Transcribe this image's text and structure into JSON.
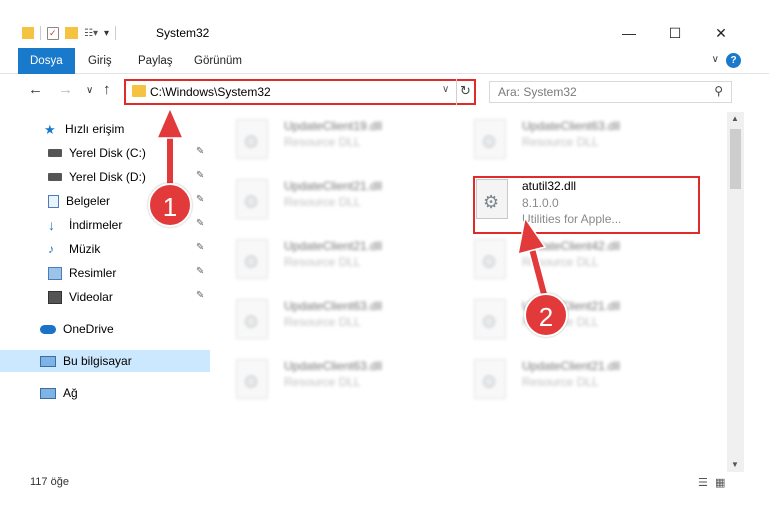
{
  "window": {
    "title": "System32",
    "min_glyph": "—",
    "max_glyph": "☐",
    "close_glyph": "✕"
  },
  "ribbon": {
    "tabs": [
      "Dosya",
      "Giriş",
      "Paylaş",
      "Görünüm"
    ],
    "active_tab": "Dosya",
    "help_glyph": "?",
    "collapse_glyph": "∨"
  },
  "navigation": {
    "back_glyph": "←",
    "forward_glyph": "→",
    "recent_glyph": "∨",
    "up_glyph": "↑",
    "address_path": "C:\\Windows\\System32",
    "address_dropdown_glyph": "∨",
    "refresh_glyph": "↻",
    "search_placeholder": "Ara: System32",
    "search_icon_glyph": "⚲"
  },
  "sidebar": {
    "items": [
      {
        "label": "Hızlı erişim",
        "icon": "star-icon",
        "pinned": false,
        "selected": false
      },
      {
        "label": "Yerel Disk (C:)",
        "icon": "drive-icon",
        "pinned": true,
        "selected": false
      },
      {
        "label": "Yerel Disk (D:)",
        "icon": "drive-icon",
        "pinned": true,
        "selected": false
      },
      {
        "label": "Belgeler",
        "icon": "documents-icon",
        "pinned": true,
        "selected": false
      },
      {
        "label": "İndirmeler",
        "icon": "download-icon",
        "pinned": true,
        "selected": false
      },
      {
        "label": "Müzik",
        "icon": "music-icon",
        "pinned": true,
        "selected": false
      },
      {
        "label": "Resimler",
        "icon": "pictures-icon",
        "pinned": true,
        "selected": false
      },
      {
        "label": "Videolar",
        "icon": "videos-icon",
        "pinned": true,
        "selected": false
      },
      {
        "label": "OneDrive",
        "icon": "cloud-icon",
        "pinned": false,
        "selected": false
      },
      {
        "label": "Bu bilgisayar",
        "icon": "computer-icon",
        "pinned": false,
        "selected": true
      },
      {
        "label": "Ağ",
        "icon": "network-icon",
        "pinned": false,
        "selected": false
      }
    ],
    "pin_glyph": "📌"
  },
  "files": [
    {
      "name": "UpdateClient19.dll",
      "desc": "Resource DLL",
      "blurred": true
    },
    {
      "name": "UpdateClient63.dll",
      "desc": "Resource DLL",
      "blurred": true
    },
    {
      "name": "UpdateClient21.dll",
      "desc": "Resource DLL",
      "blurred": true
    },
    {
      "name": "atutil32.dll",
      "desc": "8.1.0.0",
      "desc2": "Utilities for Apple...",
      "blurred": false
    },
    {
      "name": "UpdateClient21.dll",
      "desc": "Resource DLL",
      "blurred": true
    },
    {
      "name": "UpdateClient42.dll",
      "desc": "Resource DLL",
      "blurred": true
    },
    {
      "name": "UpdateClient63.dll",
      "desc": "Resource DLL",
      "blurred": true
    },
    {
      "name": "UpdateClient21.dll",
      "desc": "Resource DLL",
      "blurred": true
    },
    {
      "name": "UpdateClient63.dll",
      "desc": "Resource DLL",
      "blurred": true
    },
    {
      "name": "UpdateClient21.dll",
      "desc": "Resource DLL",
      "blurred": true
    }
  ],
  "annotations": {
    "step1": "1",
    "step2": "2"
  },
  "status": {
    "item_count": "117 öğe"
  },
  "colors": {
    "accent": "#1979ca",
    "highlight_red": "#e02b2b",
    "selected_bg": "#cce8ff"
  }
}
